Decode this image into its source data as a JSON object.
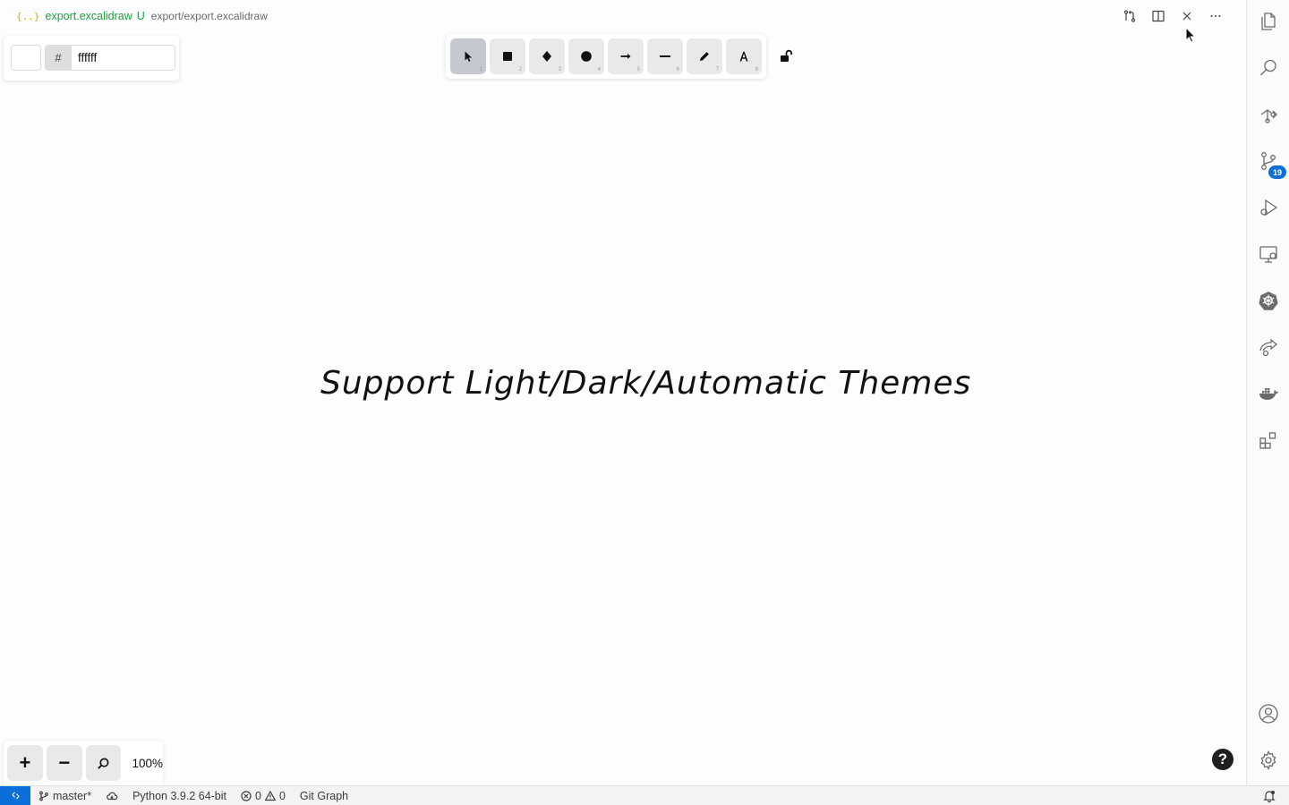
{
  "tab": {
    "icon_text": "{..}",
    "file_name": "export.excalidraw",
    "modified_indicator": "U",
    "file_path": "export/export.excalidraw"
  },
  "tab_actions": [
    "open-changes-icon",
    "split-editor-icon",
    "close-icon",
    "more-actions-icon"
  ],
  "color_picker": {
    "hash_label": "#",
    "value": "ffffff"
  },
  "toolbar": {
    "tools": [
      {
        "name": "selection",
        "icon": "pointer-icon",
        "key": "1",
        "active": true
      },
      {
        "name": "rectangle",
        "icon": "rectangle-icon",
        "key": "2",
        "active": false
      },
      {
        "name": "diamond",
        "icon": "diamond-icon",
        "key": "3",
        "active": false
      },
      {
        "name": "ellipse",
        "icon": "ellipse-icon",
        "key": "4",
        "active": false
      },
      {
        "name": "arrow",
        "icon": "arrow-icon",
        "key": "5",
        "active": false
      },
      {
        "name": "line",
        "icon": "line-icon",
        "key": "6",
        "active": false
      },
      {
        "name": "draw",
        "icon": "pencil-icon",
        "key": "7",
        "active": false
      },
      {
        "name": "text",
        "icon": "text-icon",
        "key": "8",
        "active": false
      }
    ]
  },
  "canvas": {
    "text": "Support Light/Dark/Automatic Themes"
  },
  "zoom": {
    "zoom_in_label": "+",
    "zoom_out_label": "−",
    "level": "100%"
  },
  "help_label": "?",
  "activity_bar": {
    "items": [
      "explorer-icon",
      "search-icon",
      "source-control-graph-icon",
      "source-control-icon",
      "run-debug-icon",
      "remote-explorer-icon",
      "kubernetes-icon",
      "live-share-icon",
      "docker-icon",
      "extensions-icon"
    ],
    "source_control_badge": "19",
    "bottom_items": [
      "accounts-icon",
      "manage-gear-icon"
    ]
  },
  "status_bar": {
    "branch": "master*",
    "python": "Python 3.9.2 64-bit",
    "errors": "0",
    "warnings": "0",
    "git_graph": "Git Graph"
  },
  "colors": {
    "accent": "#0a6fd8",
    "file_name": "#1d9f3d",
    "active_tool": "#c6c8cf",
    "canvas_bg": "#fdfcfe"
  }
}
